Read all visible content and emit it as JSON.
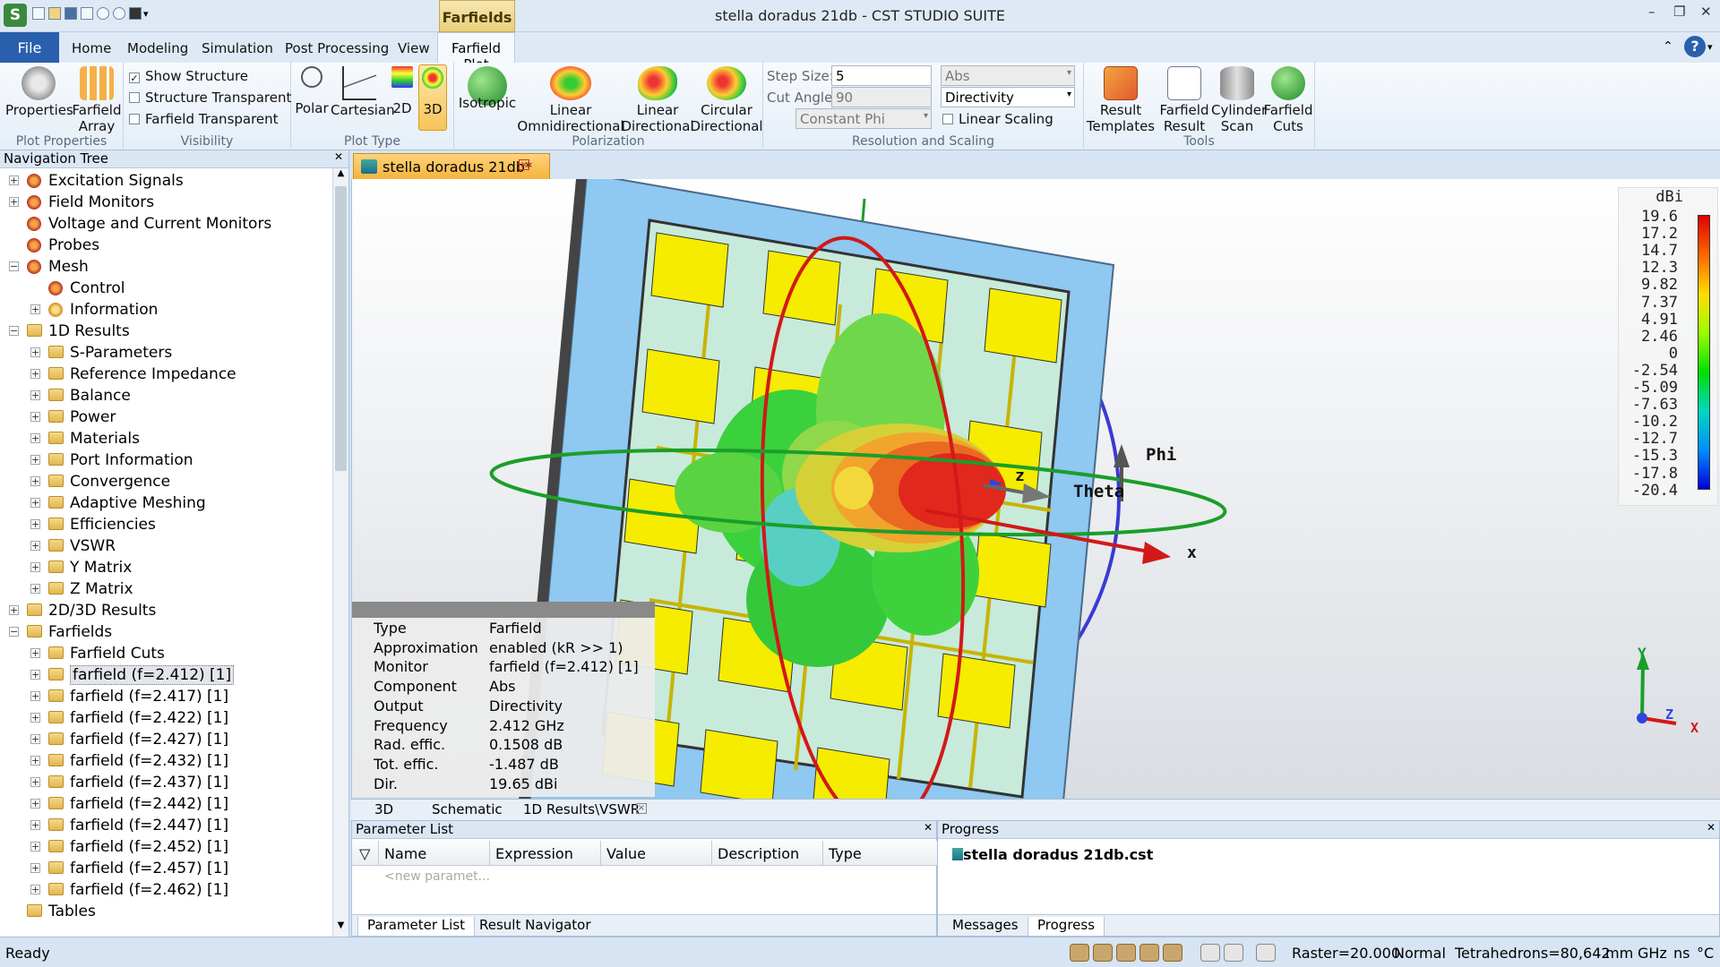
{
  "window": {
    "title": "stella doradus 21db - CST STUDIO SUITE",
    "context_tab": "Farfields"
  },
  "menu": {
    "file": "File",
    "tabs": [
      "Home",
      "Modeling",
      "Simulation",
      "Post Processing",
      "View"
    ],
    "active_tab": "Farfield Plot"
  },
  "ribbon": {
    "plot_properties": {
      "properties": "Properties",
      "farfield": "Farfield",
      "array": "Array",
      "group": "Plot Properties"
    },
    "visibility": {
      "show_structure": "Show Structure",
      "structure_transparent": "Structure Transparent",
      "farfield_transparent": "Farfield Transparent",
      "group": "Visibility"
    },
    "plot_type": {
      "polar": "Polar",
      "cartesian": "Cartesian",
      "twod": "2D",
      "threed": "3D",
      "group": "Plot Type"
    },
    "polarization": {
      "isotropic": "Isotropic",
      "linear": "Linear",
      "omni": "Omnidirectional",
      "linear2": "Linear",
      "directional": "Directional",
      "circular": "Circular",
      "directional2": "Directional",
      "group": "Polarization"
    },
    "resolution": {
      "step_label": "Step Size:",
      "step_value": "5",
      "cut_label": "Cut Angle:",
      "cut_value": "90",
      "constant": "Constant Phi",
      "abs": "Abs",
      "directivity": "Directivity",
      "linear_scaling": "Linear Scaling",
      "group": "Resolution and Scaling"
    },
    "tools": {
      "result": "Result",
      "templates": "Templates",
      "farfield": "Farfield",
      "result2": "Result",
      "cylinder": "Cylinder",
      "scan": "Scan",
      "farfield2": "Farfield",
      "cuts": "Cuts",
      "group": "Tools"
    }
  },
  "navtree": {
    "title": "Navigation Tree",
    "items": [
      {
        "label": "Excitation Signals"
      },
      {
        "label": "Field Monitors"
      },
      {
        "label": "Voltage and Current Monitors"
      },
      {
        "label": "Probes"
      },
      {
        "label": "Mesh"
      },
      {
        "label": "Control"
      },
      {
        "label": "Information"
      },
      {
        "label": "1D Results"
      },
      {
        "label": "S-Parameters"
      },
      {
        "label": "Reference Impedance"
      },
      {
        "label": "Balance"
      },
      {
        "label": "Power"
      },
      {
        "label": "Materials"
      },
      {
        "label": "Port Information"
      },
      {
        "label": "Convergence"
      },
      {
        "label": "Adaptive Meshing"
      },
      {
        "label": "Efficiencies"
      },
      {
        "label": "VSWR"
      },
      {
        "label": "Y Matrix"
      },
      {
        "label": "Z Matrix"
      },
      {
        "label": "2D/3D Results"
      },
      {
        "label": "Farfields"
      },
      {
        "label": "Farfield Cuts"
      },
      {
        "label": "farfield (f=2.412) [1]"
      },
      {
        "label": "farfield (f=2.417) [1]"
      },
      {
        "label": "farfield (f=2.422) [1]"
      },
      {
        "label": "farfield (f=2.427) [1]"
      },
      {
        "label": "farfield (f=2.432) [1]"
      },
      {
        "label": "farfield (f=2.437) [1]"
      },
      {
        "label": "farfield (f=2.442) [1]"
      },
      {
        "label": "farfield (f=2.447) [1]"
      },
      {
        "label": "farfield (f=2.452) [1]"
      },
      {
        "label": "farfield (f=2.457) [1]"
      },
      {
        "label": "farfield (f=2.462) [1]"
      },
      {
        "label": "Tables"
      }
    ]
  },
  "document": {
    "tab_label": "stella doradus 21db*"
  },
  "viewport": {
    "axis_labels": {
      "phi": "Phi",
      "theta": "Theta",
      "z": "z",
      "x": "x"
    },
    "triad": {
      "y": "Y",
      "z": "Z",
      "x": "X"
    },
    "info": [
      {
        "key": "Type",
        "value": "Farfield"
      },
      {
        "key": "Approximation",
        "value": "enabled (kR >> 1)"
      },
      {
        "key": "Monitor",
        "value": "farfield (f=2.412) [1]"
      },
      {
        "key": "Component",
        "value": "Abs"
      },
      {
        "key": "Output",
        "value": "Directivity"
      },
      {
        "key": "Frequency",
        "value": "2.412 GHz"
      },
      {
        "key": "Rad. effic.",
        "value": "0.1508 dB"
      },
      {
        "key": "Tot. effic.",
        "value": "-1.487 dB"
      },
      {
        "key": "Dir.",
        "value": "19.65 dBi"
      }
    ],
    "legend": {
      "unit": "dBi",
      "ticks": [
        "19.6",
        "17.2",
        "14.7",
        "12.3",
        "9.82",
        "7.37",
        "4.91",
        "2.46",
        "0",
        "-2.54",
        "-5.09",
        "-7.63",
        "-10.2",
        "-12.7",
        "-15.3",
        "-17.8",
        "-20.4"
      ]
    }
  },
  "view_tabs": [
    "3D",
    "Schematic",
    "1D Results\\VSWR"
  ],
  "parameter_list": {
    "title": "Parameter List",
    "columns": [
      "Name",
      "Expression",
      "Value",
      "Description",
      "Type"
    ],
    "new_placeholder": "<new paramet...",
    "tabs": [
      "Parameter List",
      "Result Navigator"
    ]
  },
  "progress": {
    "title": "Progress",
    "item": "stella doradus 21db.cst",
    "tabs": [
      "Messages",
      "Progress"
    ]
  },
  "status": {
    "ready": "Ready",
    "raster": "Raster=20.000",
    "mode": "Normal",
    "tetra": "Tetrahedrons=80,642",
    "units": [
      "mm",
      "GHz",
      "ns",
      "°C"
    ]
  }
}
